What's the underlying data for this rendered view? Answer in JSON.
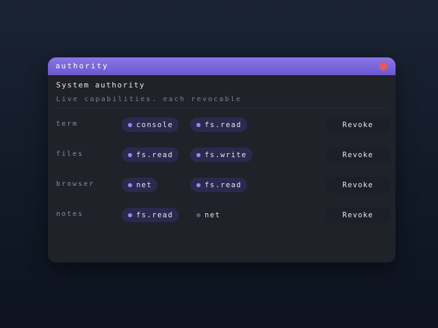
{
  "window": {
    "title": "authority"
  },
  "panel": {
    "heading": "System authority",
    "subheading": "Live capabilities. each revocable"
  },
  "rows": [
    {
      "label": "term",
      "capabilities": [
        {
          "label": "console",
          "active": true
        },
        {
          "label": "fs.read",
          "active": true
        }
      ],
      "action": "Revoke"
    },
    {
      "label": "files",
      "capabilities": [
        {
          "label": "fs.read",
          "active": true
        },
        {
          "label": "fs.write",
          "active": true
        }
      ],
      "action": "Revoke"
    },
    {
      "label": "browser",
      "capabilities": [
        {
          "label": "net",
          "active": true
        },
        {
          "label": "fs.read",
          "active": true
        }
      ],
      "action": "Revoke"
    },
    {
      "label": "notes",
      "capabilities": [
        {
          "label": "fs.read",
          "active": true
        },
        {
          "label": "net",
          "active": false
        }
      ],
      "action": "Revoke"
    }
  ],
  "colors": {
    "accent": "#7b68e0",
    "close": "#e25a5a",
    "chip_background": "#2b2a4e",
    "chip_dot": "#9a88f0",
    "chip_dot_inactive": "#5a5c6a",
    "window_background": "#1f2229"
  },
  "icons": {
    "close": "close-icon",
    "capability_dot": "dot-icon"
  }
}
